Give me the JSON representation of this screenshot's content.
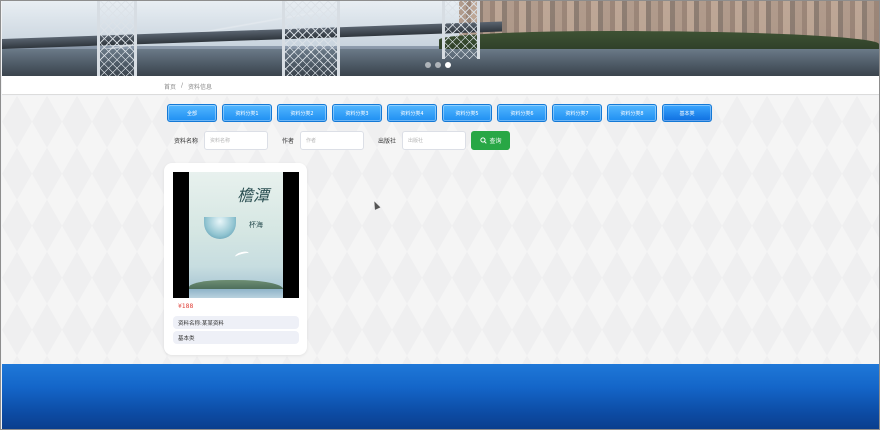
{
  "banner": {
    "slides": [
      "slide-1",
      "slide-2",
      "slide-3"
    ],
    "active_slide": 3
  },
  "breadcrumb": {
    "home": "首页",
    "separator": "/",
    "current": "资料信息"
  },
  "categories": [
    {
      "label": "全部",
      "w": 50
    },
    {
      "label": "资料分类1",
      "w": 50
    },
    {
      "label": "资料分类2",
      "w": 50
    },
    {
      "label": "资料分类3",
      "w": 50
    },
    {
      "label": "资料分类4",
      "w": 50
    },
    {
      "label": "资料分类5",
      "w": 50
    },
    {
      "label": "资料分类6",
      "w": 50
    },
    {
      "label": "资料分类7",
      "w": 50
    },
    {
      "label": "资料分类8",
      "w": 50
    },
    {
      "label": "基本类",
      "w": 50
    }
  ],
  "search": {
    "name_label": "资料名称",
    "name_placeholder": "资料名称",
    "author_label": "作者",
    "author_placeholder": "作者",
    "publisher_label": "出版社",
    "publisher_placeholder": "出版社",
    "button_label": "查询"
  },
  "items": [
    {
      "cover_title": "檐潭",
      "cover_subtitle": "杯海",
      "price": "¥188",
      "name": "资料名称:某某资料",
      "category": "基本类"
    }
  ],
  "colors": {
    "category_button": "#1f8ff2",
    "search_button": "#28a745",
    "price": "#e0423a",
    "footer": "#1466c9"
  }
}
